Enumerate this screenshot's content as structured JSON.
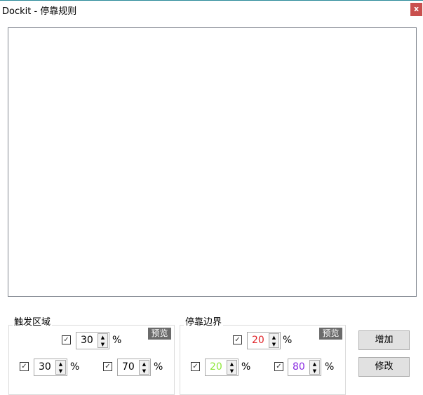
{
  "window": {
    "title": "Dockit - 停靠规则",
    "close_label": "x"
  },
  "trigger": {
    "label": "触发区域",
    "preview": "预览",
    "top": {
      "checked": true,
      "value": "30",
      "unit": "%"
    },
    "left": {
      "checked": true,
      "value": "30",
      "unit": "%"
    },
    "right": {
      "checked": true,
      "value": "70",
      "unit": "%"
    }
  },
  "border": {
    "label": "停靠边界",
    "preview": "预览",
    "top": {
      "checked": true,
      "value": "20",
      "unit": "%",
      "color": "#e0262b"
    },
    "left": {
      "checked": true,
      "value": "20",
      "unit": "%",
      "color": "#8fe83a"
    },
    "right": {
      "checked": true,
      "value": "80",
      "unit": "%",
      "color": "#8a2be2"
    }
  },
  "buttons": {
    "add": "增加",
    "edit": "修改"
  },
  "check_glyph": "✓",
  "spin_glyph": "▲▼"
}
